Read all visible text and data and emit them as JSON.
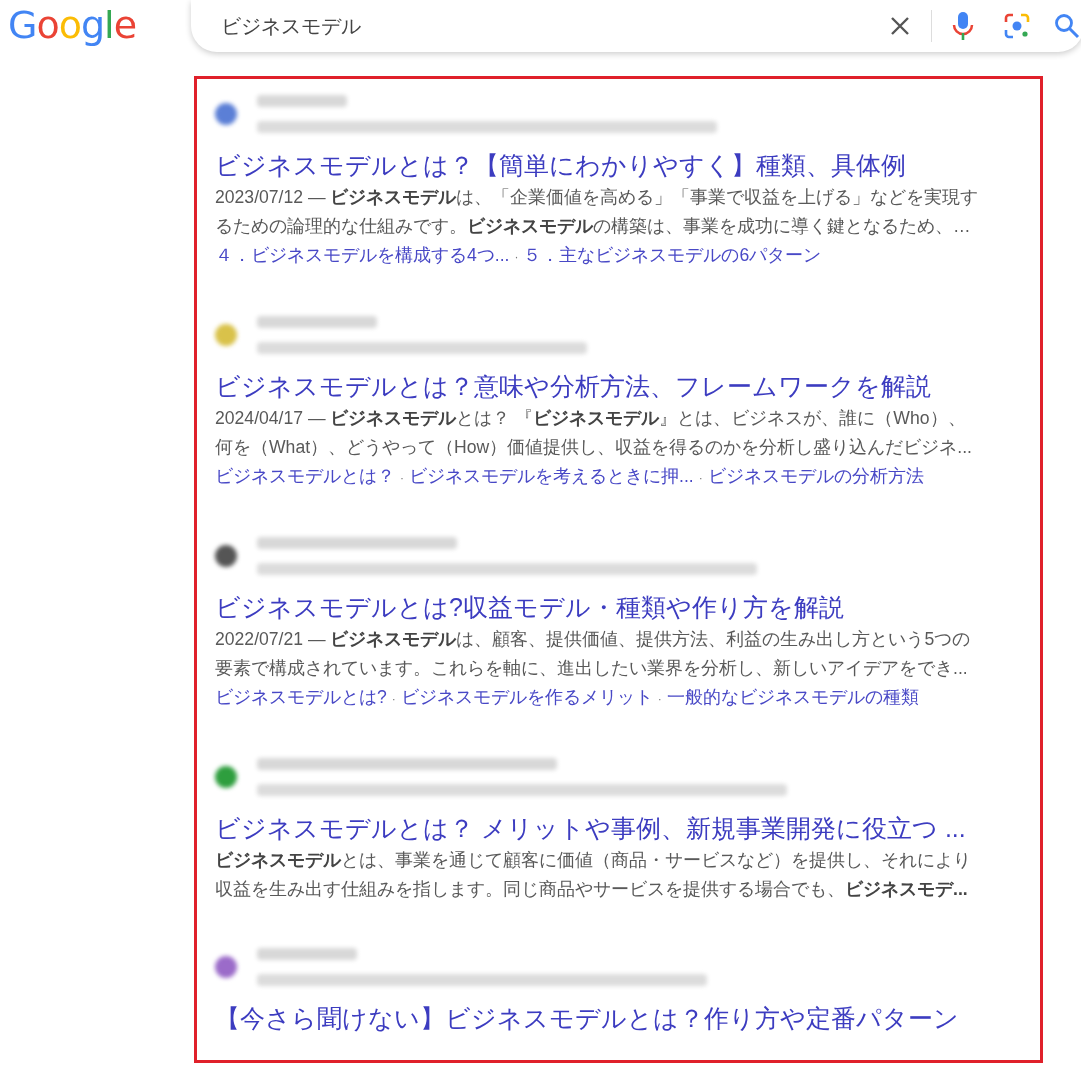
{
  "logo": "Google",
  "search": {
    "value": "ビジネスモデル"
  },
  "results": [
    {
      "color": "#5b7fd6",
      "title": "ビジネスモデルとは？【簡単にわかりやすく】種類、具体例",
      "snippet_lines": [
        "2023/07/12 — **ビジネスモデル**は、「企業価値を高める」「事業で収益を上げる」などを実現す",
        "るための論理的な仕組みです。**ビジネスモデル**の構築は、事業を成功に導く鍵となるため、…"
      ],
      "sitelinks": [
        {
          "kind": "link",
          "text": "４．ビジネスモデルを構成する4つ..."
        },
        {
          "kind": "separator",
          "text": "·"
        },
        {
          "kind": "link",
          "text": "５．主なビジネスモデルの6パターン"
        }
      ]
    },
    {
      "color": "#d9c24a",
      "title": "ビジネスモデルとは？意味や分析方法、フレームワークを解説",
      "snippet_lines": [
        "2024/04/17 — **ビジネスモデル**とは？ 『**ビジネスモデル**』とは、ビジネスが、誰に（Who）、",
        "何を（What）、どうやって（How）価値提供し、収益を得るのかを分析し盛り込んだビジネ..."
      ],
      "sitelinks": [
        {
          "kind": "link",
          "text": "ビジネスモデルとは？"
        },
        {
          "kind": "separator",
          "text": "·"
        },
        {
          "kind": "link",
          "text": "ビジネスモデルを考えるときに押..."
        },
        {
          "kind": "separator",
          "text": "·"
        },
        {
          "kind": "link",
          "text": "ビジネスモデルの分析方法"
        }
      ]
    },
    {
      "color": "#555555",
      "title": "ビジネスモデルとは?収益モデル・種類や作り方を解説",
      "snippet_lines": [
        "2022/07/21 — **ビジネスモデル**は、顧客、提供価値、提供方法、利益の生み出し方という5つの",
        "要素で構成されています。これらを軸に、進出したい業界を分析し、新しいアイデアをでき..."
      ],
      "sitelinks": [
        {
          "kind": "link",
          "text": "ビジネスモデルとは?"
        },
        {
          "kind": "separator",
          "text": "·"
        },
        {
          "kind": "link",
          "text": "ビジネスモデルを作るメリット"
        },
        {
          "kind": "separator",
          "text": "·"
        },
        {
          "kind": "link",
          "text": "一般的なビジネスモデルの種類"
        }
      ]
    },
    {
      "color": "#2e9e3e",
      "title": "ビジネスモデルとは？ メリットや事例、新規事業開発に役立つ ...",
      "snippet_lines": [
        "**ビジネスモデル**とは、事業を通じて顧客に価値（商品・サービスなど）を提供し、それにより",
        "収益を生み出す仕組みを指します。同じ商品やサービスを提供する場合でも、**ビジネスモデ...**"
      ]
    },
    {
      "color": "#9b6bc9",
      "title": "【今さら聞けない】ビジネスモデルとは？作り方や定番パターン"
    }
  ]
}
